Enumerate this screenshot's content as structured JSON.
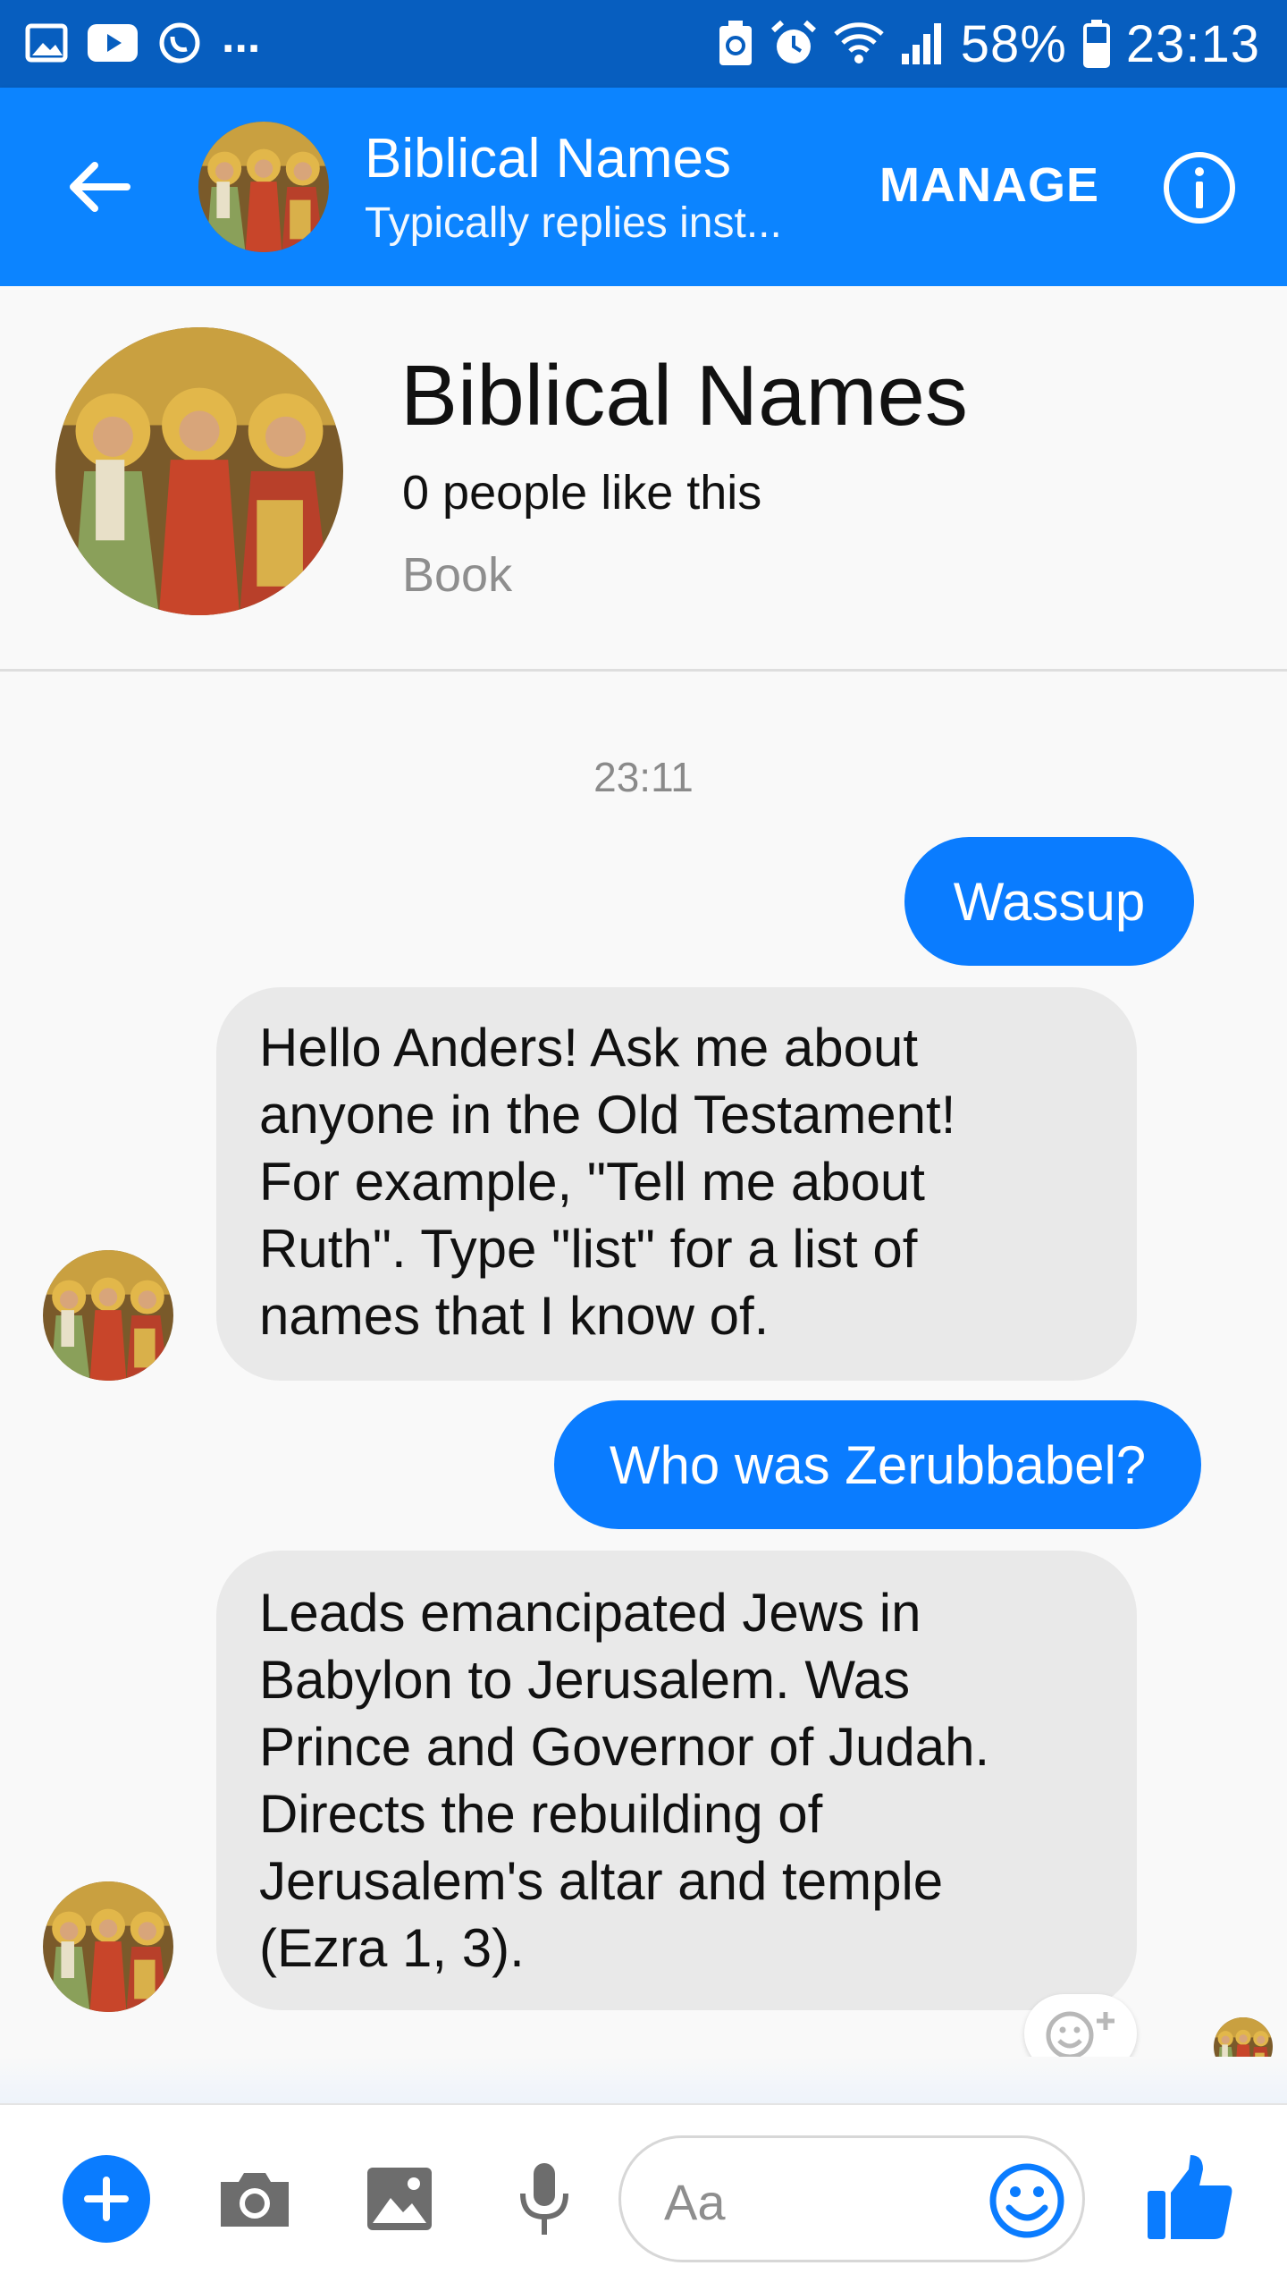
{
  "status_bar": {
    "battery": "58%",
    "time": "23:13",
    "more": "..."
  },
  "header": {
    "title": "Biblical Names",
    "subtitle": "Typically replies inst...",
    "manage_label": "MANAGE"
  },
  "profile": {
    "name": "Biblical Names",
    "likes": "0 people like this",
    "category": "Book"
  },
  "conversation": {
    "timestamp": "23:11",
    "messages": [
      {
        "from": "me",
        "text": "Wassup"
      },
      {
        "from": "page",
        "lines": [
          "Hello Anders! Ask me about",
          "anyone in the Old Testament!",
          "For example, \"Tell me about",
          "Ruth\". Type \"list\" for a list of",
          "names that I know of."
        ]
      },
      {
        "from": "me",
        "text": "Who was Zerubbabel?"
      },
      {
        "from": "page",
        "lines": [
          "Leads emancipated Jews in",
          "Babylon to Jerusalem. Was",
          "Prince and Governor of Judah.",
          "Directs the rebuilding of",
          "Jerusalem's altar and temple",
          "(Ezra 1, 3)."
        ]
      }
    ]
  },
  "composer": {
    "placeholder": "Aa"
  },
  "colors": {
    "status_bar": "#075ebf",
    "app_bar": "#0c84ff",
    "outgoing_bubble": "#0a7cff",
    "incoming_bubble": "#e9e9e9"
  },
  "icons": [
    "back-arrow-icon",
    "info-icon",
    "plus-icon",
    "camera-icon",
    "image-icon",
    "mic-icon",
    "emoji-icon",
    "thumbs-up-icon",
    "add-reaction-icon"
  ]
}
